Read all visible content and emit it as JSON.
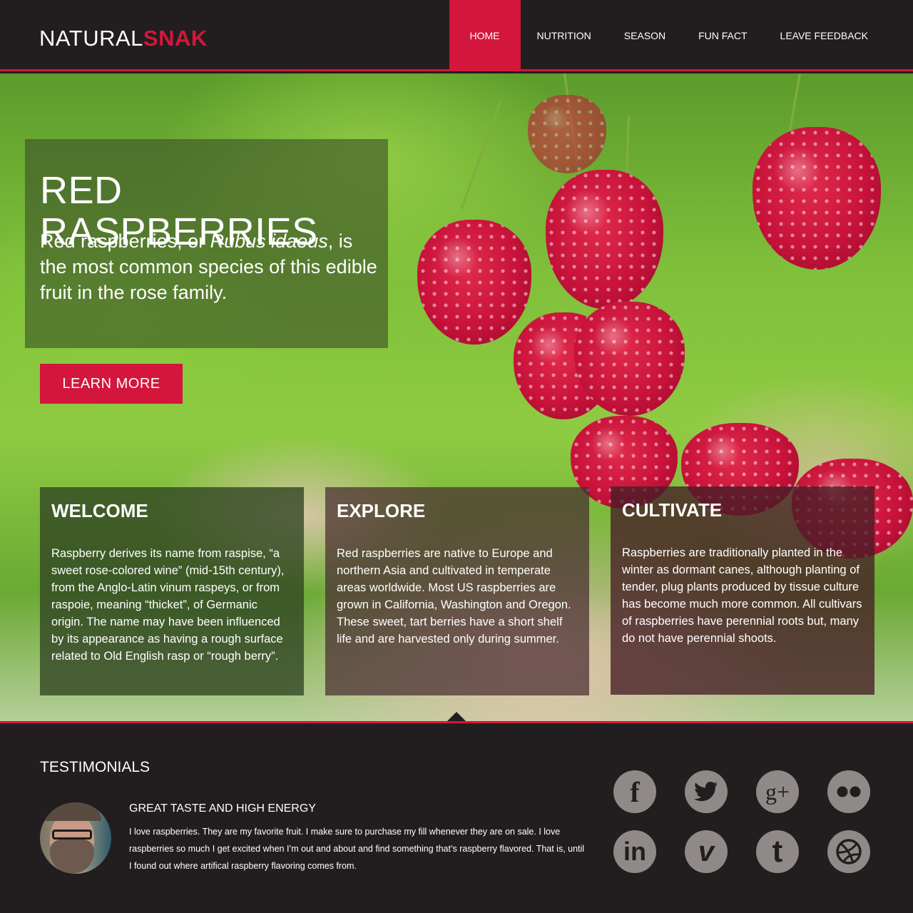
{
  "brand": {
    "part1": "NATURAL",
    "part2": "SNAK"
  },
  "nav": {
    "items": [
      {
        "label": "HOME",
        "active": true
      },
      {
        "label": "NUTRITION"
      },
      {
        "label": "SEASON"
      },
      {
        "label": "FUN FACT"
      },
      {
        "label": "LEAVE FEEDBACK"
      }
    ]
  },
  "hero": {
    "title": "RED RASPBERRIES",
    "text_before": "Red raspberries, or ",
    "text_italic": "Rubus idaeus",
    "text_after": ", is the most common species of this edible fruit in the rose family.",
    "button_label": "LEARN MORE"
  },
  "features": [
    {
      "title": "WELCOME",
      "text": "Raspberry derives its name from raspise, “a sweet rose-colored wine” (mid-15th century), from the Anglo-Latin vinum raspeys, or from raspoie, meaning “thicket”, of Germanic origin. The name may have been influenced by its appearance as having a rough surface related to Old English rasp or “rough berry”."
    },
    {
      "title": "EXPLORE",
      "text": "Red raspberries are native to Europe and northern Asia and cultivated in temperate areas worldwide. Most US raspberries are grown in California, Washington and Oregon.\nThese sweet, tart berries have a short shelf life and are harvested only during summer."
    },
    {
      "title": "CULTIVATE",
      "text": "Raspberries are traditionally planted in the winter as dormant canes, although planting of tender, plug plants produced by tissue culture has become much more common. All cultivars of raspberries have perennial roots but, many do not have perennial shoots."
    }
  ],
  "testimonials": {
    "title": "TESTIMONIALS",
    "quote_title": "GREAT TASTE AND HIGH ENERGY",
    "quote_text": "I love raspberries. They are my favorite fruit. I make sure to purchase my fill whenever they are on sale. I love raspberries so much I get excited when I’m out and about and find something that’s raspberry flavored. That is, until I found out where artifical raspberry flavoring comes from."
  },
  "social": [
    {
      "icon": "facebook-icon",
      "glyph": "f"
    },
    {
      "icon": "twitter-icon",
      "glyph": ""
    },
    {
      "icon": "google-plus-icon",
      "glyph": "g+"
    },
    {
      "icon": "flickr-icon",
      "glyph": ""
    },
    {
      "icon": "linkedin-icon",
      "glyph": "in"
    },
    {
      "icon": "vimeo-icon",
      "glyph": "v"
    },
    {
      "icon": "tumblr-icon",
      "glyph": "t"
    },
    {
      "icon": "dribbble-icon",
      "glyph": ""
    }
  ],
  "colors": {
    "accent": "#d4163c",
    "background": "#221e1f",
    "icon_gray": "#8f8a88"
  }
}
